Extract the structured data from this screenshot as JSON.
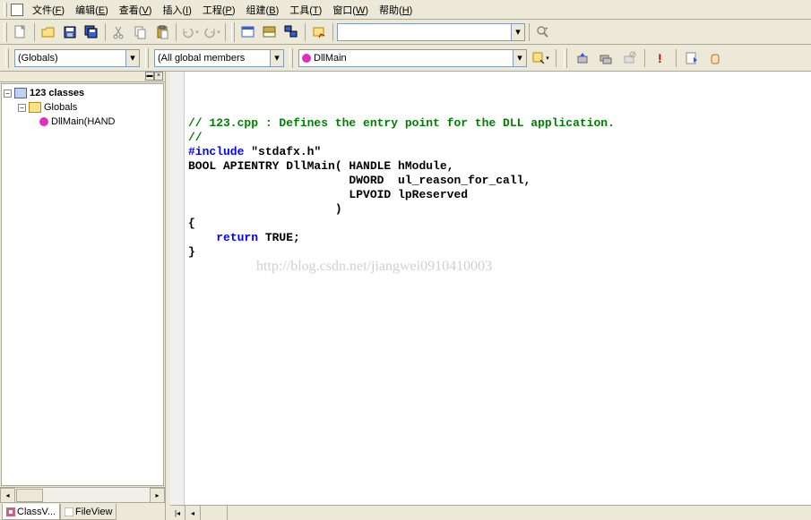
{
  "menu": {
    "items": [
      {
        "label": "文件",
        "accel": "F"
      },
      {
        "label": "编辑",
        "accel": "E"
      },
      {
        "label": "查看",
        "accel": "V"
      },
      {
        "label": "插入",
        "accel": "I"
      },
      {
        "label": "工程",
        "accel": "P"
      },
      {
        "label": "组建",
        "accel": "B"
      },
      {
        "label": "工具",
        "accel": "T"
      },
      {
        "label": "窗口",
        "accel": "W"
      },
      {
        "label": "帮助",
        "accel": "H"
      }
    ]
  },
  "toolbar": {
    "icons": [
      "new-file",
      "open",
      "save",
      "save-all",
      "cut",
      "copy",
      "paste",
      "undo",
      "redo",
      "workspace",
      "window-list",
      "tile",
      "find-in-files"
    ],
    "search_value": ""
  },
  "wizard": {
    "scope_label": "(Globals)",
    "members_label": "(All global members",
    "function_label": "DllMain",
    "icons_right": [
      "build",
      "rebuild",
      "stop-build",
      "breakpoint",
      "toggle-bp",
      "quick-watch",
      "hand"
    ]
  },
  "sidebar": {
    "root": "123 classes",
    "globals": "Globals",
    "func": "DllMain(HAND",
    "tabs": [
      {
        "icon": "class",
        "label": "ClassV..."
      },
      {
        "icon": "file",
        "label": "FileView"
      }
    ]
  },
  "code": {
    "lines": [
      {
        "cls": "c-comment",
        "text": "// 123.cpp : Defines the entry point for the DLL application."
      },
      {
        "cls": "c-comment",
        "text": "//"
      },
      {
        "cls": "",
        "text": ""
      },
      {
        "cls": "c-pre",
        "text": "#include \"stdafx.h\""
      },
      {
        "cls": "",
        "text": ""
      },
      {
        "cls": "c-txt",
        "text": "BOOL APIENTRY DllMain( HANDLE hModule, "
      },
      {
        "cls": "c-txt",
        "text": "                       DWORD  ul_reason_for_call, "
      },
      {
        "cls": "c-txt",
        "text": "                       LPVOID lpReserved"
      },
      {
        "cls": "c-txt",
        "text": "                     )"
      },
      {
        "cls": "c-txt",
        "text": "{"
      },
      {
        "cls": "c-txt",
        "text": "    return TRUE;",
        "kw": "return",
        "rest": " TRUE;"
      },
      {
        "cls": "c-txt",
        "text": "}"
      }
    ],
    "watermark": "http://blog.csdn.net/jiangwei0910410003"
  }
}
